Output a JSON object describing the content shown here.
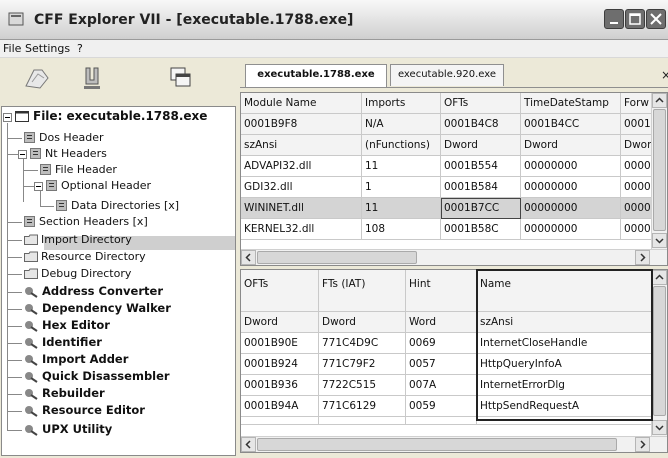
{
  "window": {
    "title": "CFF Explorer VII - [executable.1788.exe]"
  },
  "menu": {
    "items": [
      "File",
      "Settings",
      "?"
    ]
  },
  "toolbar": {
    "icons": [
      "open-file-icon",
      "save-icon",
      "windows-icon"
    ]
  },
  "tree": {
    "root": "File: executable.1788.exe",
    "items": [
      "Dos Header",
      "Nt Headers",
      "File Header",
      "Optional Header",
      "Data Directories [x]",
      "Section Headers [x]",
      "Import Directory",
      "Resource Directory",
      "Debug Directory",
      "Address Converter",
      "Dependency Walker",
      "Hex Editor",
      "Identifier",
      "Import Adder",
      "Quick Disassembler",
      "Rebuilder",
      "Resource Editor",
      "UPX Utility"
    ],
    "selected": "Import Directory"
  },
  "tabs": [
    {
      "label": "executable.1788.exe",
      "active": true
    },
    {
      "label": "executable.920.exe",
      "active": false
    }
  ],
  "tab_close": "×",
  "modules_table": {
    "headers": [
      "Module Name",
      "Imports",
      "OFTs",
      "TimeDateStamp",
      "Forw"
    ],
    "subheader1": [
      "0001B9F8",
      "N/A",
      "0001B4C8",
      "0001B4CC",
      "0001"
    ],
    "subheader2": [
      "szAnsi",
      "(nFunctions)",
      "Dword",
      "Dword",
      "Dwor"
    ],
    "rows": [
      [
        "ADVAPI32.dll",
        "11",
        "0001B554",
        "00000000",
        "0000"
      ],
      [
        "GDI32.dll",
        "1",
        "0001B584",
        "00000000",
        "0000"
      ],
      [
        "WININET.dll",
        "11",
        "0001B7CC",
        "00000000",
        "0000"
      ],
      [
        "KERNEL32.dll",
        "108",
        "0001B58C",
        "00000000",
        "0000"
      ]
    ],
    "selected_row": 2
  },
  "functions_table": {
    "headers": [
      "OFTs",
      "FTs (IAT)",
      "Hint",
      "Name"
    ],
    "subheader": [
      "Dword",
      "Dword",
      "Word",
      "szAnsi"
    ],
    "rows": [
      [
        "0001B90E",
        "771C4D9C",
        "0069",
        "InternetCloseHandle"
      ],
      [
        "0001B924",
        "771C79F2",
        "0057",
        "HttpQueryInfoA"
      ],
      [
        "0001B936",
        "7722C515",
        "007A",
        "InternetErrorDlg"
      ],
      [
        "0001B94A",
        "771C6129",
        "0059",
        "HttpSendRequestA"
      ]
    ]
  }
}
